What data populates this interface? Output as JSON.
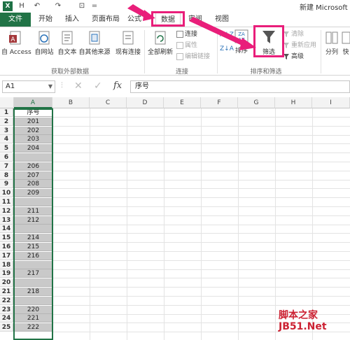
{
  "app": {
    "logo_letter": "X",
    "title": "新建 Microsoft E",
    "quick_access": [
      "H",
      "↶",
      "↷",
      "⊡",
      "="
    ]
  },
  "tabs": [
    {
      "label": "文件"
    },
    {
      "label": "开始"
    },
    {
      "label": "插入"
    },
    {
      "label": "页面布局"
    },
    {
      "label": "公式"
    },
    {
      "label": "数据"
    },
    {
      "label": "审阅"
    },
    {
      "label": "视图"
    }
  ],
  "ribbon": {
    "external_data": {
      "group_label": "获取外部数据",
      "buttons": [
        "自 Access",
        "自网站",
        "自文本",
        "自其他来源",
        "现有连接"
      ]
    },
    "connections": {
      "group_label": "连接",
      "refresh_all": "全部刷新",
      "items": [
        "连接",
        "属性",
        "编辑链接"
      ]
    },
    "sort_filter": {
      "group_label": "排序和筛选",
      "sort": "排序",
      "filter": "筛选",
      "items": [
        "清除",
        "重新应用",
        "高级"
      ]
    },
    "data_tools": {
      "split": "分列",
      "fill": "快"
    }
  },
  "formula_bar": {
    "name_box": "A1",
    "fx_label": "fx",
    "content": "序号"
  },
  "columns": [
    "A",
    "B",
    "C",
    "D",
    "E",
    "F",
    "G",
    "H",
    "I"
  ],
  "rows": [
    {
      "n": "1",
      "a": "序号"
    },
    {
      "n": "2",
      "a": "201"
    },
    {
      "n": "3",
      "a": "202"
    },
    {
      "n": "4",
      "a": "203"
    },
    {
      "n": "5",
      "a": "204"
    },
    {
      "n": "6",
      "a": ""
    },
    {
      "n": "7",
      "a": "206"
    },
    {
      "n": "8",
      "a": "207"
    },
    {
      "n": "9",
      "a": "208"
    },
    {
      "n": "10",
      "a": "209"
    },
    {
      "n": "11",
      "a": ""
    },
    {
      "n": "12",
      "a": "211"
    },
    {
      "n": "13",
      "a": "212"
    },
    {
      "n": "14",
      "a": ""
    },
    {
      "n": "15",
      "a": "214"
    },
    {
      "n": "16",
      "a": "215"
    },
    {
      "n": "17",
      "a": "216"
    },
    {
      "n": "18",
      "a": ""
    },
    {
      "n": "19",
      "a": "217"
    },
    {
      "n": "20",
      "a": ""
    },
    {
      "n": "21",
      "a": "218"
    },
    {
      "n": "22",
      "a": ""
    },
    {
      "n": "23",
      "a": "220"
    },
    {
      "n": "24",
      "a": "221"
    },
    {
      "n": "25",
      "a": "222"
    }
  ],
  "watermark": {
    "line1": "脚本之家",
    "line2": "JB51.Net"
  },
  "colors": {
    "excel_green": "#217346",
    "highlight": "#e91e7a"
  }
}
